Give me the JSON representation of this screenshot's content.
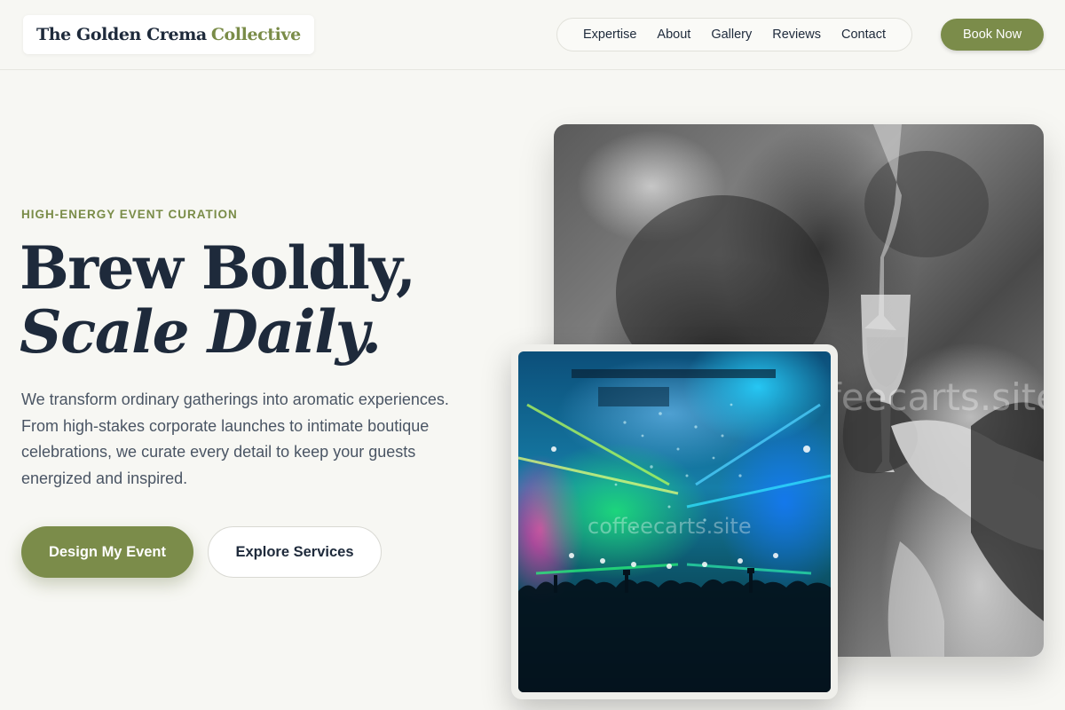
{
  "brand": {
    "name_main": "The Golden Crema",
    "name_accent": "Collective",
    "accent_color": "#7b8c4a",
    "text_color": "#1e2a3b"
  },
  "nav": {
    "items": [
      {
        "label": "Expertise"
      },
      {
        "label": "About"
      },
      {
        "label": "Gallery"
      },
      {
        "label": "Reviews"
      },
      {
        "label": "Contact"
      }
    ],
    "cta_label": "Book Now"
  },
  "hero": {
    "eyebrow": "HIGH-ENERGY EVENT CURATION",
    "headline_line1": "Brew Boldly,",
    "headline_line2": "Scale Daily.",
    "lede": "We transform ordinary gatherings into aromatic experiences. From high-stakes corporate launches to intimate boutique celebrations, we curate every detail to keep your guests energized and inspired.",
    "primary_cta": "Design My Event",
    "secondary_cta": "Explore Services"
  },
  "images": {
    "back_photo": {
      "subject": "black-and-white celebration toast with champagne glasses",
      "watermark": "coffeecarts.site"
    },
    "front_photo": {
      "subject": "colorful concert stage with lasers, confetti and crowd",
      "watermark": "coffeecarts.site"
    }
  }
}
